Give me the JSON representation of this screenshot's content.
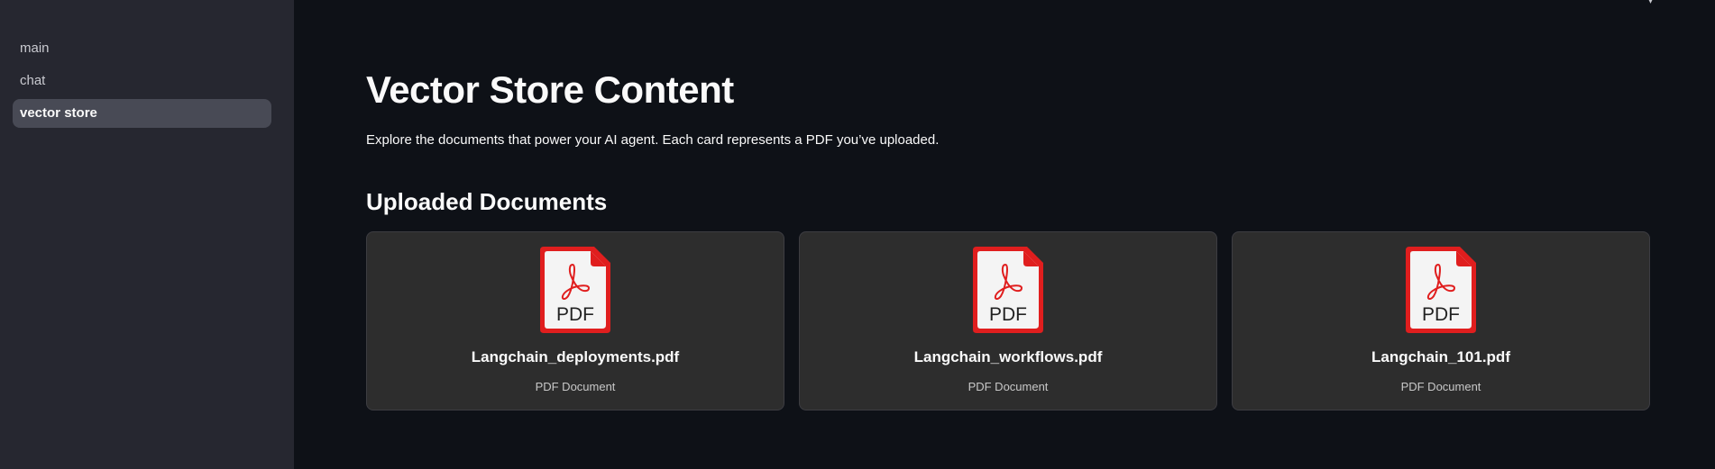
{
  "sidebar": {
    "items": [
      {
        "label": "main",
        "active": false
      },
      {
        "label": "chat",
        "active": false
      },
      {
        "label": "vector store",
        "active": true
      }
    ]
  },
  "main": {
    "title": "Vector Store Content",
    "description": "Explore the documents that power your AI agent. Each card represents a PDF you’ve uploaded.",
    "section_title": "Uploaded Documents",
    "cards": [
      {
        "name": "Langchain_deployments.pdf",
        "type": "PDF Document",
        "icon": "pdf-file-icon",
        "icon_label": "PDF"
      },
      {
        "name": "Langchain_workflows.pdf",
        "type": "PDF Document",
        "icon": "pdf-file-icon",
        "icon_label": "PDF"
      },
      {
        "name": "Langchain_101.pdf",
        "type": "PDF Document",
        "icon": "pdf-file-icon",
        "icon_label": "PDF"
      }
    ]
  },
  "colors": {
    "background": "#0e1117",
    "sidebar": "#262730",
    "active_nav": "#484a55",
    "card": "#2d2d2d",
    "pdf_red": "#e01e1e"
  }
}
